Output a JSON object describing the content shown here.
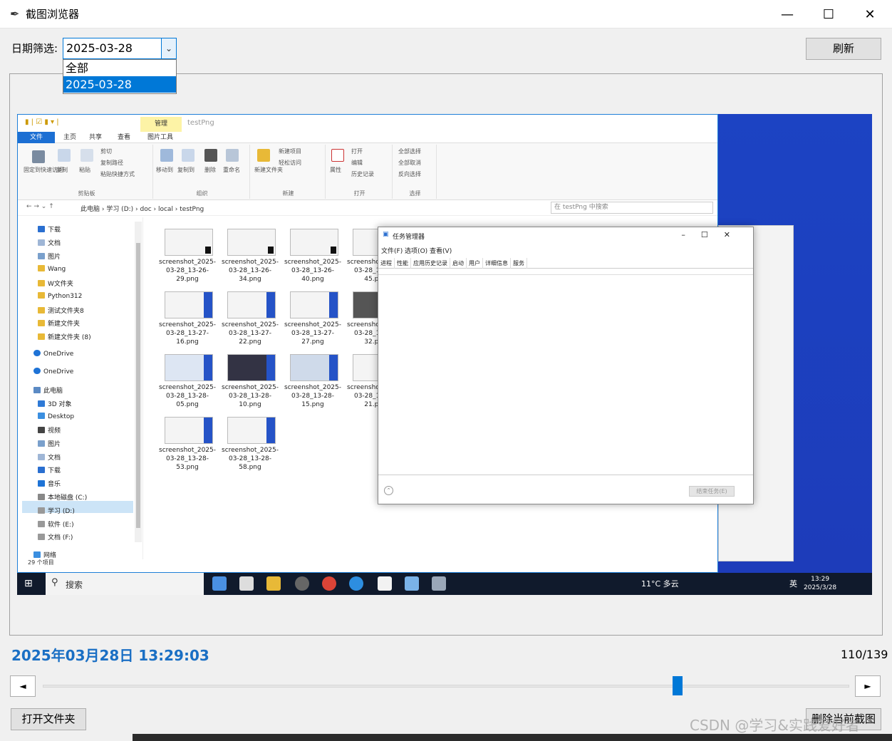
{
  "window": {
    "title": "截图浏览器",
    "minimize": "—",
    "maximize": "☐",
    "close": "✕"
  },
  "filter": {
    "label": "日期筛选:",
    "selected": "2025-03-28",
    "options": [
      "全部",
      "2025-03-28"
    ]
  },
  "toolbar": {
    "refresh_label": "刷新"
  },
  "screenshot": {
    "explorer": {
      "context_tab": "管理",
      "window_title": "testPng",
      "ribbon_tabs": [
        "文件",
        "主页",
        "共享",
        "查看",
        "图片工具"
      ],
      "ribbon_groups": [
        "剪贴板",
        "组织",
        "新建",
        "打开",
        "选择"
      ],
      "ribbon_labels": [
        "固定到快速访问",
        "复制",
        "粘贴",
        "剪切",
        "复制路径",
        "粘贴快捷方式",
        "移动到",
        "复制到",
        "删除",
        "重命名",
        "新建文件夹",
        "新建项目",
        "轻松访问",
        "属性",
        "打开",
        "编辑",
        "历史记录",
        "全部选择",
        "全部取消",
        "反向选择"
      ],
      "breadcrumb": "此电脑 › 学习 (D:) › doc › local › testPng",
      "search_placeholder": "在 testPng 中搜索",
      "nav_items": [
        "下载",
        "文档",
        "图片",
        "Wang",
        "W文件夹",
        "Python312",
        "测试文件夹8",
        "新建文件夹",
        "新建文件夹 (8)",
        "OneDrive",
        "OneDrive",
        "此电脑",
        "3D 对象",
        "Desktop",
        "视频",
        "图片",
        "文档",
        "下载",
        "音乐",
        "本地磁盘 (C:)",
        "学习 (D:)",
        "软件 (E:)",
        "文档 (F:)",
        "网络"
      ],
      "files": [
        "screenshot_2025-03-28_13-26-29.png",
        "screenshot_2025-03-28_13-26-34.png",
        "screenshot_2025-03-28_13-26-40.png",
        "screenshot_2025-03-28_13-26-45.png",
        "screenshot_2025-03-28_13-27-16.png",
        "screenshot_2025-03-28_13-27-22.png",
        "screenshot_2025-03-28_13-27-27.png",
        "screenshot_2025-03-28_13-27-32.png",
        "screenshot_2025-03-28_13-28-05.png",
        "screenshot_2025-03-28_13-28-10.png",
        "screenshot_2025-03-28_13-28-15.png",
        "screenshot_2025-03-28_13-28-21.png",
        "screenshot_2025-03-28_13-28-53.png",
        "screenshot_2025-03-28_13-28-58.png"
      ],
      "status": "29 个项目"
    },
    "task_manager": {
      "title": "任务管理器",
      "menu": "文件(F)  选项(O)  查看(V)",
      "tabs": [
        "进程",
        "性能",
        "应用历史记录",
        "启动",
        "用户",
        "详细信息",
        "服务"
      ],
      "end_task": "结束任务(E)"
    },
    "taskbar": {
      "search": "搜索",
      "weather": "11°C 多云",
      "ime": "英",
      "time": "13:29",
      "date": "2025/3/28"
    }
  },
  "status": {
    "datetime": "2025年03月28日  13:29:03",
    "counter": "110/139",
    "progress_fraction": 0.791
  },
  "buttons": {
    "prev": "◄",
    "next": "►",
    "open_folder": "打开文件夹",
    "delete_current": "删除当前截图"
  },
  "watermark": "CSDN @学习&实践爱好者"
}
